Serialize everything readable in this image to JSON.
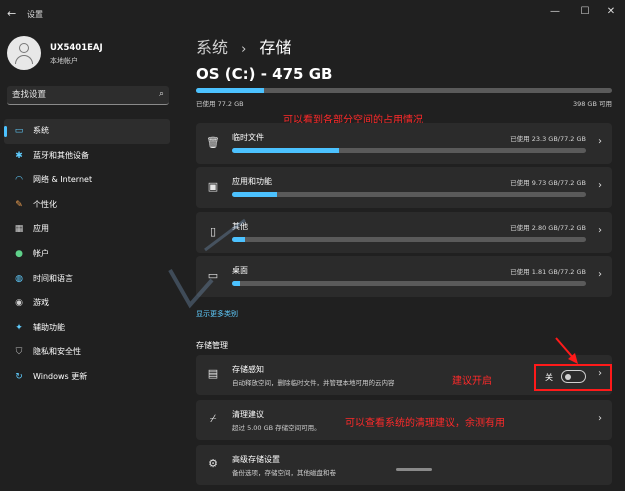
{
  "window": {
    "title": "设置",
    "back_icon": "back-arrow-icon",
    "controls": [
      "minimize-icon",
      "maximize-icon",
      "close-icon"
    ]
  },
  "account": {
    "name": "UX5401EAJ",
    "type": "本地帐户"
  },
  "search": {
    "placeholder": "查找设置"
  },
  "nav": {
    "items": [
      {
        "label": "系统",
        "icon": "monitor-icon",
        "active": true
      },
      {
        "label": "蓝牙和其他设备",
        "icon": "bluetooth-icon"
      },
      {
        "label": "网络 & Internet",
        "icon": "wifi-icon"
      },
      {
        "label": "个性化",
        "icon": "brush-icon"
      },
      {
        "label": "应用",
        "icon": "apps-icon"
      },
      {
        "label": "帐户",
        "icon": "person-icon"
      },
      {
        "label": "时间和语言",
        "icon": "globe-clock-icon"
      },
      {
        "label": "游戏",
        "icon": "gamepad-icon"
      },
      {
        "label": "辅助功能",
        "icon": "accessibility-icon"
      },
      {
        "label": "隐私和安全性",
        "icon": "shield-icon"
      },
      {
        "label": "Windows 更新",
        "icon": "update-icon"
      }
    ]
  },
  "breadcrumb": {
    "parent": "系统",
    "separator": "›",
    "current": "存储"
  },
  "drive": {
    "title": "OS (C:) - 475 GB",
    "used_label": "已使用 77.2 GB",
    "free_label": "398 GB 可用",
    "used_fraction": 0.163
  },
  "annotations": {
    "top": "可以看到各部分空间的占用情况",
    "sense": "建议开启",
    "cleanup": "可以查看系统的清理建议，余测有用"
  },
  "categories": [
    {
      "name": "临时文件",
      "used": "已使用 23.3 GB/77.2 GB",
      "fraction": 0.302,
      "icon": "trash-icon"
    },
    {
      "name": "应用和功能",
      "used": "已使用 9.73 GB/77.2 GB",
      "fraction": 0.126,
      "icon": "apps-features-icon"
    },
    {
      "name": "其他",
      "used": "已使用 2.80 GB/77.2 GB",
      "fraction": 0.036,
      "icon": "document-icon"
    },
    {
      "name": "桌面",
      "used": "已使用 1.81 GB/77.2 GB",
      "fraction": 0.023,
      "icon": "desktop-icon"
    }
  ],
  "more_link": "显示更多类别",
  "management": {
    "title": "存储管理",
    "storage_sense": {
      "title": "存储感知",
      "desc": "自动释放空间，删除临时文件，并管理本地可用的云内容",
      "toggle_label": "关",
      "toggle_on": false,
      "icon": "storage-sense-icon"
    },
    "cleanup": {
      "title": "清理建议",
      "desc": "超过 5.00 GB 存储空间可用。",
      "icon": "broom-icon"
    },
    "advanced": {
      "title": "高级存储设置",
      "desc": "备份选项，存储空间，其他磁盘和卷",
      "icon": "gear-icon"
    }
  },
  "colors": {
    "accent": "#4cc2ff",
    "annotation": "#ff2a2a",
    "background": "#202020",
    "card": "#2b2b2b"
  }
}
